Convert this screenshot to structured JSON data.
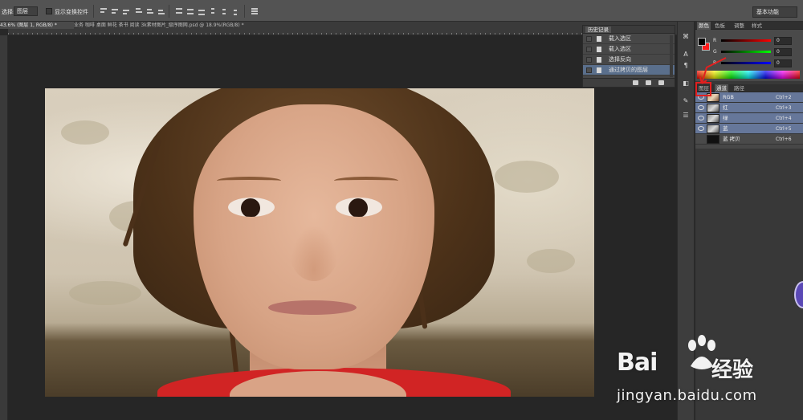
{
  "options_bar": {
    "mode_label": "选择:",
    "layer_select": "图层",
    "show_transform_label": "显示变换控件",
    "workspace": "基本功能"
  },
  "tabs": [
    {
      "label": "43.6% (图层 1, RGB/8) *"
    },
    {
      "label": "业务 咖啡 桌面 鲜花 茶书  阅读 3k素材图片_级序图网.psd @ 18.9%(RGB/8) *"
    }
  ],
  "history_panel": {
    "title": "历史记录",
    "items": [
      {
        "label": "载入选区"
      },
      {
        "label": "载入选区"
      },
      {
        "label": "选择反向"
      },
      {
        "label": "通过拷贝的图层"
      }
    ]
  },
  "color_panel": {
    "tabs": [
      "颜色",
      "色板",
      "调整",
      "样式"
    ],
    "channels": [
      {
        "label": "R",
        "value": "0"
      },
      {
        "label": "G",
        "value": "0"
      },
      {
        "label": "B",
        "value": "0"
      }
    ],
    "foreground": "#000000",
    "background": "#ff1b1b"
  },
  "channels_panel": {
    "tabs": [
      "图层",
      "通道",
      "路径"
    ],
    "items": [
      {
        "name": "RGB",
        "shortcut": "Ctrl+2"
      },
      {
        "name": "红",
        "shortcut": "Ctrl+3"
      },
      {
        "name": "绿",
        "shortcut": "Ctrl+4"
      },
      {
        "name": "蓝",
        "shortcut": "Ctrl+5"
      },
      {
        "name": "蓝 拷贝",
        "shortcut": "Ctrl+6"
      }
    ]
  },
  "watermark": {
    "brand": "Bai",
    "brand_cn": "经验",
    "url": "jingyan.baidu.com"
  }
}
